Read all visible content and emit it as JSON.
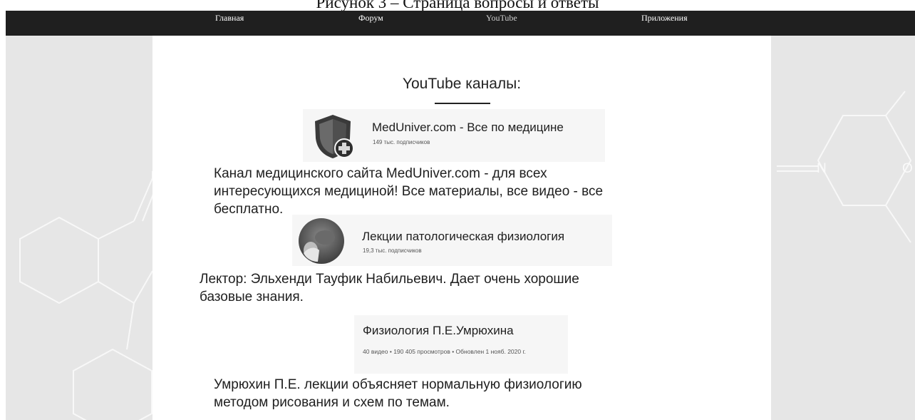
{
  "caption": "Рисунок 3 – Страница вопросы и ответы",
  "nav": {
    "items": [
      {
        "label": "Главная",
        "active": false
      },
      {
        "label": "Форум",
        "active": false
      },
      {
        "label": "YouTube",
        "active": true
      },
      {
        "label": "Приложения",
        "active": false
      }
    ]
  },
  "background": {
    "molecule_letters": [
      "N",
      "O"
    ]
  },
  "main": {
    "title": "YouTube каналы:",
    "channels": [
      {
        "name": "MedUniver.com - Все по медицине",
        "subscribers": "149 тыс. подписчиков",
        "icon": "shield-plus-logo",
        "description": "Канал медицинского сайта MedUniver.com - для всех интересующихся медициной! Все материалы, все видео - все бесплатно."
      },
      {
        "name": "Лекции патологическая физиология",
        "subscribers": "19,3 тыс. подписчиков",
        "icon": "round-avatar",
        "description": "Лектор: Эльхенди Тауфик Набильевич. Дает очень хорошие базовые знания."
      },
      {
        "name": "Физиология П.Е.Умрюхина",
        "meta": "40 видео • 190 405 просмотров • Обновлен 1 нояб. 2020 г.",
        "description": "Умрюхин П.Е. лекции объясняет нормальную физиологию методом рисования и схем по темам."
      }
    ]
  }
}
